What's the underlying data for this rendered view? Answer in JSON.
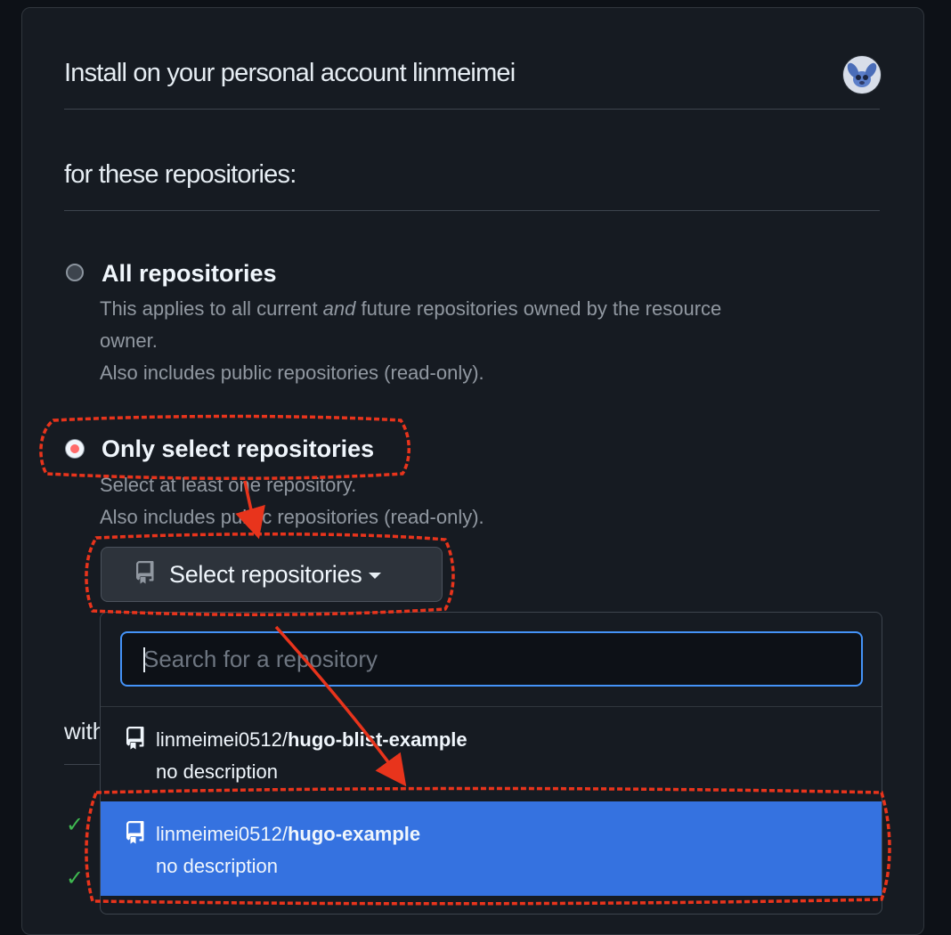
{
  "install": {
    "title": "Install on your personal account linmeimei"
  },
  "repositories": {
    "section_label": "for these repositories:",
    "options": [
      {
        "title": "All repositories",
        "desc_pre": "This applies to all current ",
        "desc_em": "and",
        "desc_post": " future repositories owned by the resource",
        "desc_line2": "owner.",
        "desc_line3": "Also includes public repositories (read-only).",
        "selected": false
      },
      {
        "title": "Only select repositories",
        "desc_line1": "Select at least one repository.",
        "desc_line2": "Also includes public repositories (read-only).",
        "selected": true
      }
    ],
    "select_button_label": "Select repositories"
  },
  "dropdown": {
    "search_placeholder": "Search for a repository",
    "items": [
      {
        "owner": "linmeimei0512/",
        "repo": "hugo-blist-example",
        "description": "no description",
        "selected": false
      },
      {
        "owner": "linmeimei0512/",
        "repo": "hugo-example",
        "description": "no description",
        "selected": true
      }
    ]
  },
  "behind": {
    "partial_text": "with",
    "checkmark": "✓"
  },
  "colors": {
    "accent_blue": "#3572e0",
    "annotation_red": "#e8341c",
    "check_green": "#3fb950"
  }
}
